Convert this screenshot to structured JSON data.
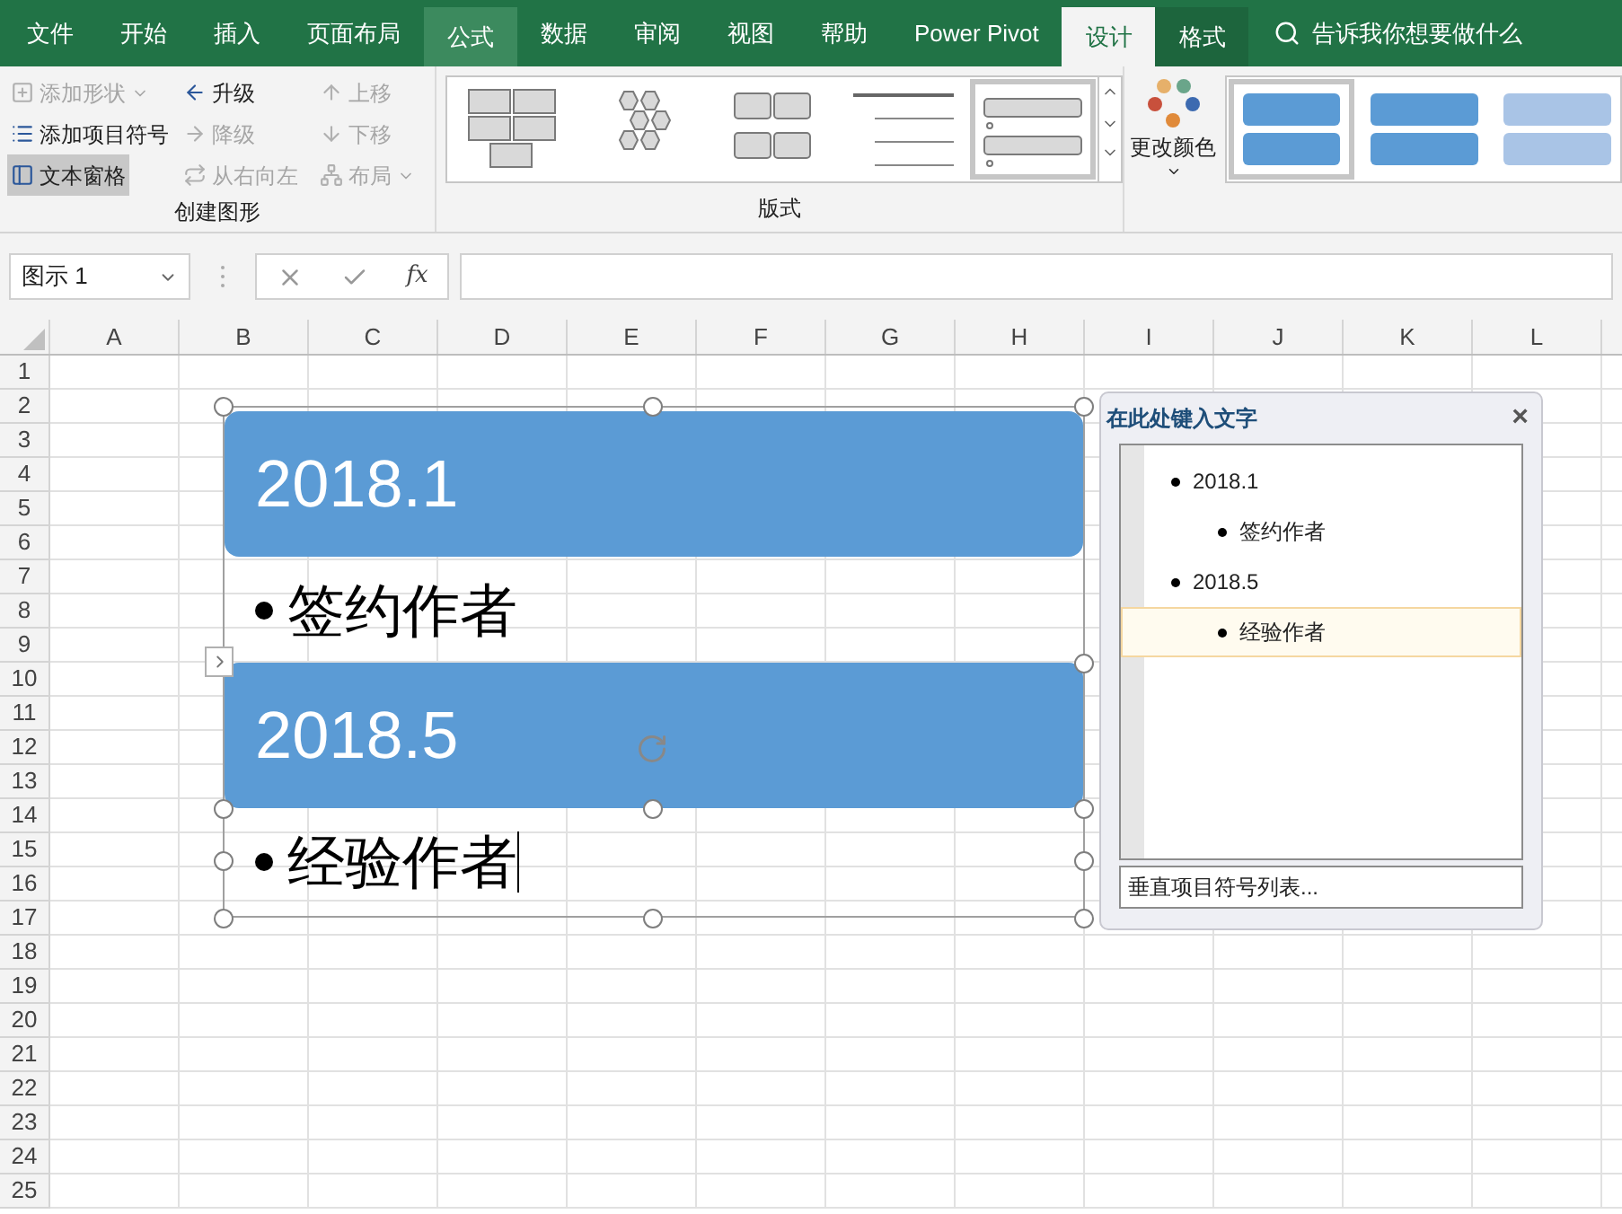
{
  "tabs": [
    {
      "label": "文件",
      "selected": false,
      "hovered": false,
      "contextual": false
    },
    {
      "label": "开始",
      "selected": false,
      "hovered": false,
      "contextual": false
    },
    {
      "label": "插入",
      "selected": false,
      "hovered": false,
      "contextual": false
    },
    {
      "label": "页面布局",
      "selected": false,
      "hovered": false,
      "contextual": false
    },
    {
      "label": "公式",
      "selected": false,
      "hovered": true,
      "contextual": false
    },
    {
      "label": "数据",
      "selected": false,
      "hovered": false,
      "contextual": false
    },
    {
      "label": "审阅",
      "selected": false,
      "hovered": false,
      "contextual": false
    },
    {
      "label": "视图",
      "selected": false,
      "hovered": false,
      "contextual": false
    },
    {
      "label": "帮助",
      "selected": false,
      "hovered": false,
      "contextual": false
    },
    {
      "label": "Power Pivot",
      "selected": false,
      "hovered": false,
      "contextual": false
    },
    {
      "label": "设计",
      "selected": true,
      "hovered": false,
      "contextual": true
    },
    {
      "label": "格式",
      "selected": false,
      "hovered": false,
      "contextual": true
    }
  ],
  "tell_me": {
    "placeholder": "告诉我你想要做什么"
  },
  "create_group": {
    "label": "创建图形",
    "buttons": [
      {
        "label": "添加形状",
        "disabled": true,
        "dropdown": true,
        "selected": false
      },
      {
        "label": "升级",
        "disabled": false,
        "dropdown": false,
        "selected": false
      },
      {
        "label": "上移",
        "disabled": true,
        "dropdown": false,
        "selected": false
      },
      {
        "label": "添加项目符号",
        "disabled": false,
        "dropdown": false,
        "selected": false
      },
      {
        "label": "降级",
        "disabled": true,
        "dropdown": false,
        "selected": false
      },
      {
        "label": "下移",
        "disabled": true,
        "dropdown": false,
        "selected": false
      },
      {
        "label": "文本窗格",
        "disabled": false,
        "dropdown": false,
        "selected": true
      },
      {
        "label": "从右向左",
        "disabled": true,
        "dropdown": false,
        "selected": false
      },
      {
        "label": "布局",
        "disabled": true,
        "dropdown": true,
        "selected": false
      }
    ]
  },
  "layouts_group": {
    "label": "版式",
    "layouts": [
      {
        "selected": false
      },
      {
        "selected": false
      },
      {
        "selected": false
      },
      {
        "selected": false
      },
      {
        "selected": true
      }
    ]
  },
  "change_colors": {
    "label": "更改颜色"
  },
  "styles": [
    {
      "selected": true
    },
    {
      "selected": false
    },
    {
      "selected": false
    }
  ],
  "formula_bar": {
    "name_box": "图示 1",
    "function_label": "fx"
  },
  "columns": [
    "A",
    "B",
    "C",
    "D",
    "E",
    "F",
    "G",
    "H",
    "I",
    "J",
    "K",
    "L"
  ],
  "rows": [
    "1",
    "2",
    "3",
    "4",
    "5",
    "6",
    "7",
    "8",
    "9",
    "10",
    "11",
    "12",
    "13",
    "14",
    "15",
    "16",
    "17",
    "18",
    "19",
    "20",
    "21",
    "22",
    "23",
    "24",
    "25"
  ],
  "smartart": [
    {
      "title": "2018.1",
      "bullet": "签约作者"
    },
    {
      "title": "2018.5",
      "bullet": "经验作者"
    }
  ],
  "text_pane": {
    "title": "在此处键入文字",
    "close": "×",
    "items": [
      {
        "text": "2018.1",
        "selected": false,
        "children": [
          {
            "text": "签约作者",
            "selected": false
          }
        ]
      },
      {
        "text": "2018.5",
        "selected": false,
        "children": [
          {
            "text": "经验作者",
            "selected": true
          }
        ]
      }
    ],
    "layout_name": "垂直项目符号列表..."
  }
}
